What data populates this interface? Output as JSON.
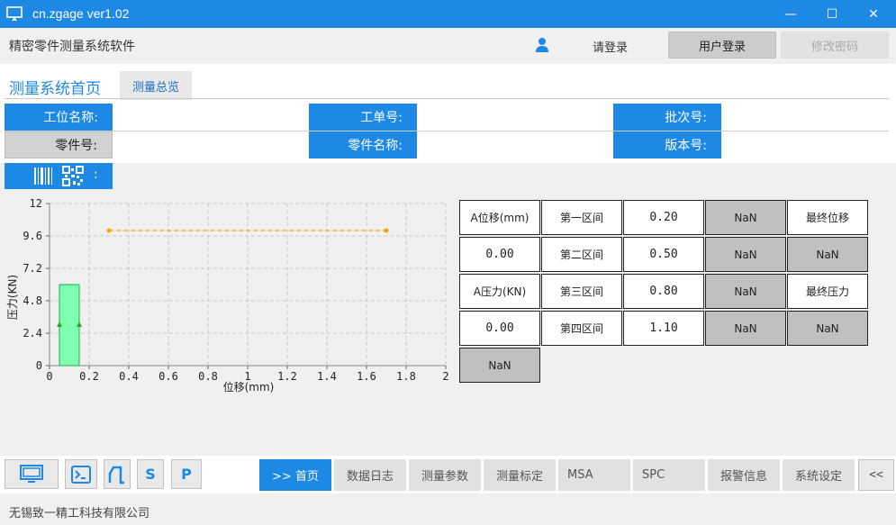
{
  "window": {
    "title": "cn.zgage ver1.02",
    "minimize": "—",
    "maximize": "☐",
    "close": "✕"
  },
  "header": {
    "app_name": "精密零件测量系统软件",
    "login_prompt": "请登录",
    "login_button": "用户登录",
    "change_password_button": "修改密码"
  },
  "tabs": {
    "home": "测量系统首页",
    "overview": "测量总览"
  },
  "info": {
    "station": "工位名称:",
    "order": "工单号:",
    "batch": "批次号:",
    "part_no": "零件号:",
    "part_name": "零件名称:",
    "version": "版本号:"
  },
  "barcode": {
    "colon": ":"
  },
  "chart_data": {
    "type": "line",
    "xlabel": "位移(mm)",
    "ylabel": "压力(KN)",
    "xlim": [
      0,
      2
    ],
    "ylim": [
      0,
      12
    ],
    "xticks": [
      "0",
      "0.2",
      "0.4",
      "0.6",
      "0.8",
      "1",
      "1.2",
      "1.4",
      "1.6",
      "1.8",
      "2"
    ],
    "yticks": [
      "0",
      "2.4",
      "4.8",
      "7.2",
      "9.6",
      "12"
    ],
    "grid": true,
    "series": [
      {
        "x": [
          0.3,
          1.7
        ],
        "y": [
          10,
          10
        ],
        "color": "#ffa500",
        "style": "dashed"
      }
    ],
    "bands": [
      {
        "x0": 0.05,
        "x1": 0.15,
        "y0": 0,
        "y1": 6,
        "color": "#7fffb0"
      }
    ],
    "markers": [
      {
        "x": 0.05,
        "y": 3,
        "color": "#22aa22"
      },
      {
        "x": 0.15,
        "y": 3,
        "color": "#22aa22"
      }
    ]
  },
  "measurements": {
    "rows": [
      [
        "A位移(mm)",
        "第一区间",
        "0.20",
        "NaN",
        "最终位移"
      ],
      [
        "0.00",
        "第二区间",
        "0.50",
        "NaN",
        "NaN"
      ],
      [
        "A压力(KN)",
        "第三区间",
        "0.80",
        "NaN",
        "最终压力"
      ],
      [
        "0.00",
        "第四区间",
        "1.10",
        "NaN",
        "NaN"
      ],
      [
        "NaN"
      ]
    ]
  },
  "toolbar": {
    "s_label": "S",
    "p_label": "P"
  },
  "nav": {
    "home": ">> 首页",
    "log": "数据日志",
    "params": "测量参数",
    "calibration": "测量标定",
    "msa": "MSA",
    "spc": "SPC",
    "alarm": "报警信息",
    "settings": "系统设定",
    "collapse": "<<"
  },
  "status": {
    "company": "无锡致一精工科技有限公司"
  }
}
